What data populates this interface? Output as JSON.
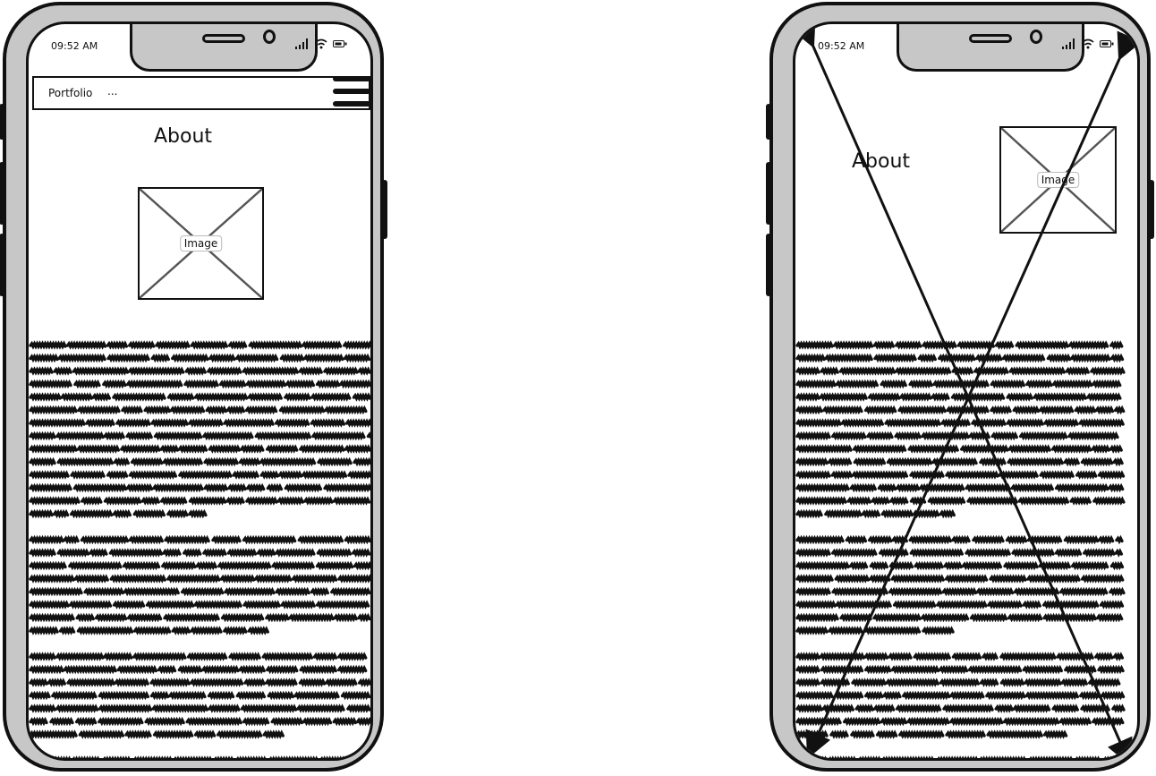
{
  "left_phone": {
    "status": {
      "time": "09:52 AM"
    },
    "navbar": {
      "title": "Portfolio",
      "more": "..."
    },
    "heading": "About",
    "image_label": "Image"
  },
  "right_phone": {
    "status": {
      "time": "09:52 AM"
    },
    "heading": "About",
    "image_label": "Image"
  },
  "icons": [
    "signal-icon",
    "wifi-icon",
    "battery-icon",
    "hamburger-menu-icon",
    "image-placeholder-icon"
  ]
}
